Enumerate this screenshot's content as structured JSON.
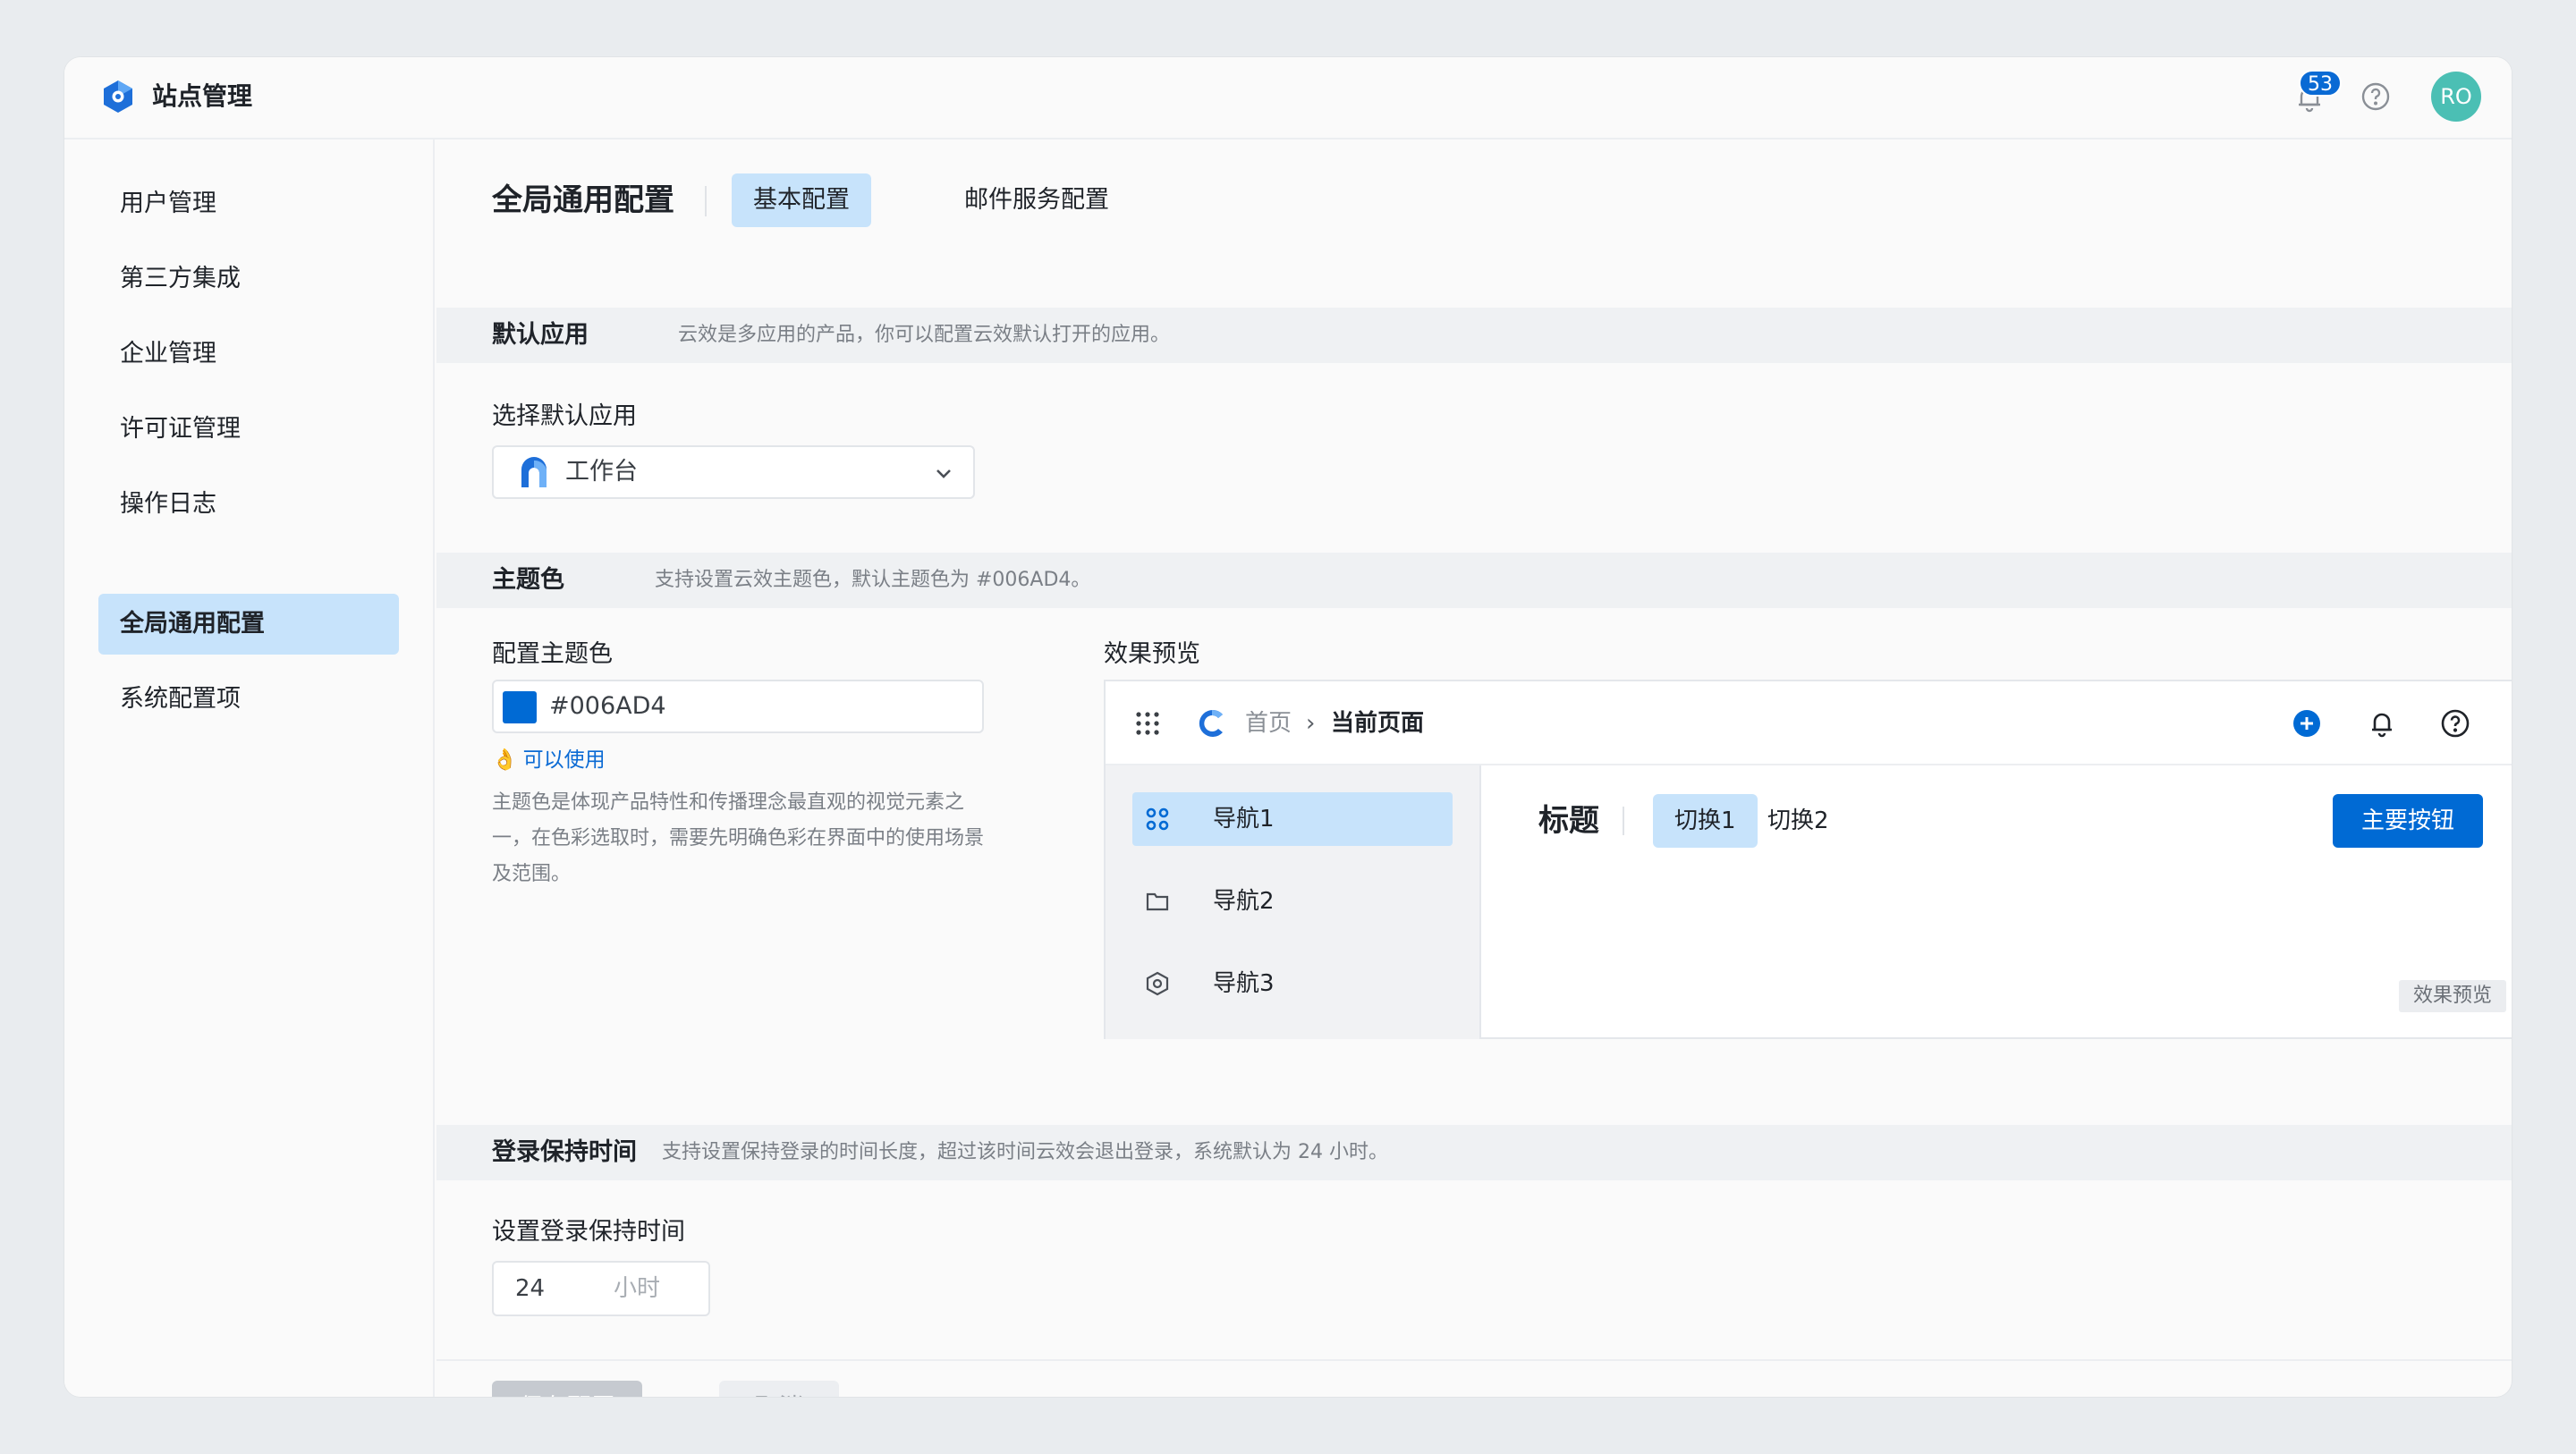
{
  "header": {
    "app_title": "站点管理",
    "notification_count": "53",
    "avatar_initials": "RO"
  },
  "sidebar": {
    "items": [
      {
        "label": "用户管理"
      },
      {
        "label": "第三方集成"
      },
      {
        "label": "企业管理"
      },
      {
        "label": "许可证管理"
      },
      {
        "label": "操作日志"
      },
      {
        "label": "全局通用配置",
        "active": true
      },
      {
        "label": "系统配置项"
      }
    ]
  },
  "main": {
    "page_title": "全局通用配置",
    "tabs": [
      {
        "label": "基本配置",
        "active": true
      },
      {
        "label": "邮件服务配置"
      }
    ]
  },
  "default_app": {
    "section_title": "默认应用",
    "section_desc": "云效是多应用的产品，你可以配置云效默认打开的应用。",
    "field_label": "选择默认应用",
    "selected_value": "工作台"
  },
  "theme": {
    "section_title": "主题色",
    "section_desc": "支持设置云效主题色，默认主题色为 #006AD4。",
    "field_label": "配置主题色",
    "color_value": "#006AD4",
    "color_hex": "#006AD4",
    "status_text": "可以使用",
    "help_text": "主题色是体现产品特性和传播理念最直观的视觉元素之一，在色彩选取时，需要先明确色彩在界面中的使用场景及范围。",
    "preview_label": "效果预览"
  },
  "preview": {
    "breadcrumb_home": "首页",
    "breadcrumb_separator": "›",
    "breadcrumb_current": "当前页面",
    "nav_items": [
      {
        "label": "导航1",
        "icon": "grid-icon",
        "active": true
      },
      {
        "label": "导航2",
        "icon": "folder-icon"
      },
      {
        "label": "导航3",
        "icon": "settings-icon"
      }
    ],
    "main_title": "标题",
    "tabs": [
      {
        "label": "切换1",
        "active": true
      },
      {
        "label": "切换2"
      }
    ],
    "primary_button": "主要按钮",
    "watermark_tag": "效果预览"
  },
  "login": {
    "section_title": "登录保持时间",
    "section_desc": "支持设置保持登录的时间长度，超过该时间云效会退出登录，系统默认为 24 小时。",
    "field_label": "设置登录保持时间",
    "value": "24",
    "unit": "小时"
  },
  "footer": {
    "save_label": "保存配置",
    "cancel_label": "取消"
  },
  "colors": {
    "brand": "#006AD4",
    "active_bg": "#c7e3fb",
    "avatar_bg": "#4bbfb4"
  }
}
